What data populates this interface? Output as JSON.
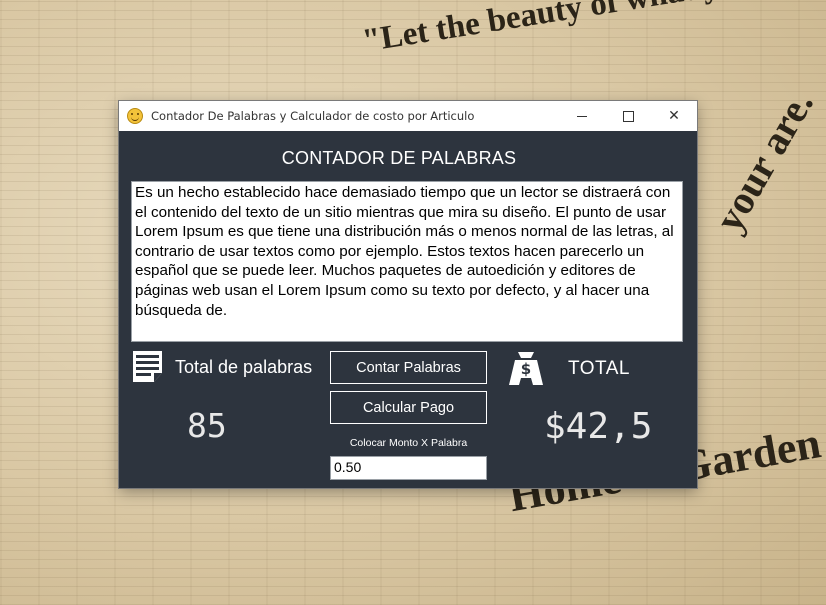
{
  "background": {
    "headline_1": "\"Let the beauty of what you do.\"",
    "headline_2": "Home & Garden",
    "headline_3": "your are."
  },
  "window": {
    "title": "Contador De Palabras y Calculador de costo por Articulo",
    "minimize_symbol": "—",
    "close_symbol": "✕"
  },
  "app": {
    "heading": "CONTADOR DE PALABRAS",
    "text_input": "Es un hecho establecido hace demasiado tiempo que un lector se distraerá con el contenido del texto de un sitio mientras que mira su diseño. El punto de usar Lorem Ipsum es que tiene una distribución más o menos normal de las letras, al contrario de usar textos como por ejemplo. Estos textos hacen parecerlo un español que se puede leer. Muchos paquetes de autoedición y editores de páginas web usan el Lorem Ipsum como su texto por defecto, y al hacer una búsqueda de.",
    "total_words_label": "Total de palabras",
    "word_count": "85",
    "count_button": "Contar Palabras",
    "calc_button": "Calcular Pago",
    "rate_label": "Colocar Monto X Palabra",
    "rate_value": "0.50",
    "total_label": "TOTAL",
    "total_value": "$42,5"
  },
  "colors": {
    "panel_bg": "#2d343e",
    "titlebar_bg": "#ffffff",
    "text_light": "#ffffff"
  },
  "icons": [
    "app-emoji-icon",
    "document-lines-icon",
    "money-bag-icon",
    "minimize-icon",
    "maximize-icon",
    "close-icon"
  ]
}
